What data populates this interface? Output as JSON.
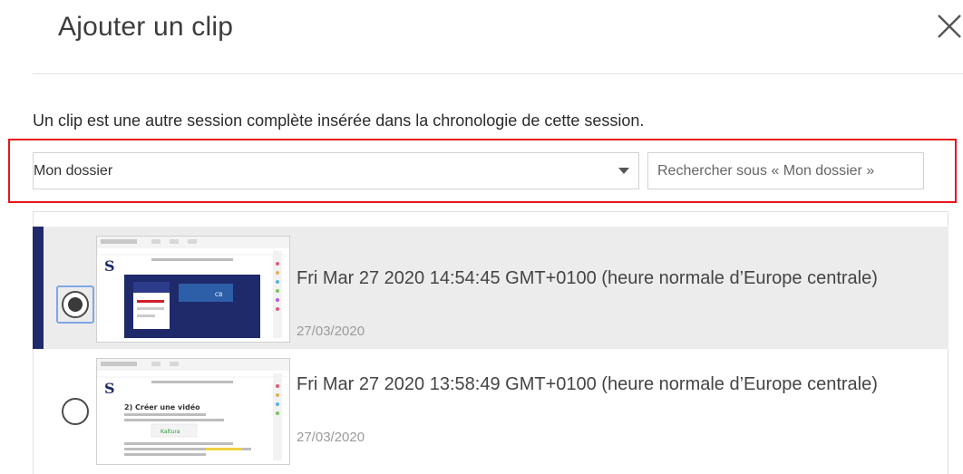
{
  "dialog": {
    "title": "Ajouter un clip",
    "close_icon": "close-icon"
  },
  "description": "Un clip est une autre session complète insérée dans la chronologie de cette session.",
  "filters": {
    "folder_selected": "Mon dossier",
    "search_placeholder": "Rechercher sous « Mon dossier »"
  },
  "clips": [
    {
      "title": "Fri Mar 27 2020 14:54:45 GMT+0100 (heure normale d’Europe centrale)",
      "date": "27/03/2020",
      "selected": true,
      "thumbnail": {
        "logo": "S",
        "panel_text": "CB"
      }
    },
    {
      "title": "Fri Mar 27 2020 13:58:49 GMT+0100 (heure normale d’Europe centrale)",
      "date": "27/03/2020",
      "selected": false,
      "thumbnail": {
        "logo": "S",
        "heading": "2) Créer une vidéo",
        "badge": "Kaltura"
      }
    }
  ],
  "colors": {
    "accent": "#1f2a6b",
    "highlight": "#e8141c",
    "selected_row": "#ececec"
  }
}
